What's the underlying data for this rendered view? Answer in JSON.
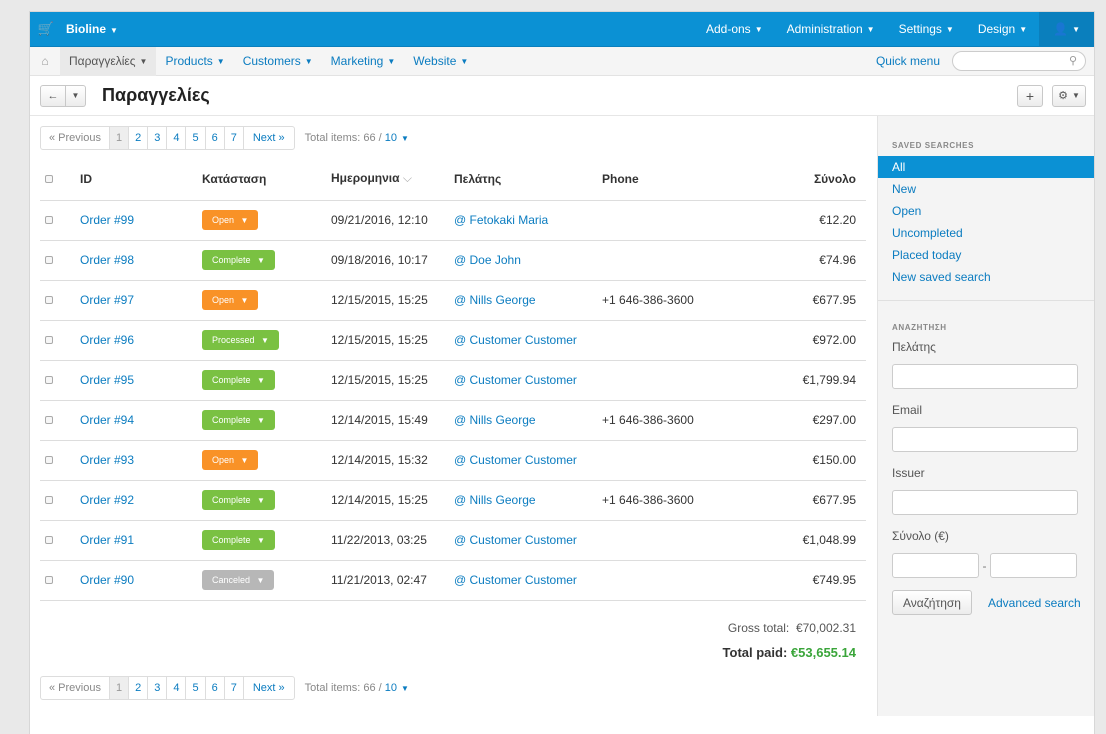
{
  "topbar": {
    "brand": "Bioline",
    "nav": [
      "Add-ons",
      "Administration",
      "Settings",
      "Design"
    ]
  },
  "subnav": {
    "items": [
      "Παραγγελίες",
      "Products",
      "Customers",
      "Marketing",
      "Website"
    ],
    "quick_menu": "Quick menu"
  },
  "page": {
    "title": "Παραγγελίες"
  },
  "pager": {
    "prev": "« Previous",
    "pages": [
      "1",
      "2",
      "3",
      "4",
      "5",
      "6",
      "7"
    ],
    "next": "Next »",
    "total_label": "Total items: 66 / ",
    "per_page": "10"
  },
  "table": {
    "headers": {
      "id": "ID",
      "status": "Κατάσταση",
      "date": "Ημερομηνια",
      "customer": "Πελάτης",
      "phone": "Phone",
      "total": "Σύνολο"
    },
    "rows": [
      {
        "id": "Order #99",
        "status": "Open",
        "status_type": "open",
        "date": "09/21/2016, 12:10",
        "customer": "@ Fetokaki Maria",
        "phone": "",
        "total": "€12.20"
      },
      {
        "id": "Order #98",
        "status": "Complete",
        "status_type": "complete",
        "date": "09/18/2016, 10:17",
        "customer": "@ Doe John",
        "phone": "",
        "total": "€74.96"
      },
      {
        "id": "Order #97",
        "status": "Open",
        "status_type": "open",
        "date": "12/15/2015, 15:25",
        "customer": "@ Nills George",
        "phone": "+1 646-386-3600",
        "total": "€677.95"
      },
      {
        "id": "Order #96",
        "status": "Processed",
        "status_type": "processed",
        "date": "12/15/2015, 15:25",
        "customer": "@ Customer Customer",
        "phone": "",
        "total": "€972.00"
      },
      {
        "id": "Order #95",
        "status": "Complete",
        "status_type": "complete",
        "date": "12/15/2015, 15:25",
        "customer": "@ Customer Customer",
        "phone": "",
        "total": "€1,799.94"
      },
      {
        "id": "Order #94",
        "status": "Complete",
        "status_type": "complete",
        "date": "12/14/2015, 15:49",
        "customer": "@ Nills George",
        "phone": "+1 646-386-3600",
        "total": "€297.00"
      },
      {
        "id": "Order #93",
        "status": "Open",
        "status_type": "open",
        "date": "12/14/2015, 15:32",
        "customer": "@ Customer Customer",
        "phone": "",
        "total": "€150.00"
      },
      {
        "id": "Order #92",
        "status": "Complete",
        "status_type": "complete",
        "date": "12/14/2015, 15:25",
        "customer": "@ Nills George",
        "phone": "+1 646-386-3600",
        "total": "€677.95"
      },
      {
        "id": "Order #91",
        "status": "Complete",
        "status_type": "complete",
        "date": "11/22/2013, 03:25",
        "customer": "@ Customer Customer",
        "phone": "",
        "total": "€1,048.99"
      },
      {
        "id": "Order #90",
        "status": "Canceled",
        "status_type": "canceled",
        "date": "11/21/2013, 02:47",
        "customer": "@ Customer Customer",
        "phone": "",
        "total": "€749.95"
      }
    ]
  },
  "totals": {
    "gross_label": "Gross total:",
    "gross_value": "€70,002.31",
    "paid_label": "Total paid:",
    "paid_value": "€53,655.14"
  },
  "sidebar": {
    "saved_title": "SAVED SEARCHES",
    "saved": [
      "All",
      "New",
      "Open",
      "Uncompleted",
      "Placed today",
      "New saved search"
    ],
    "search_title": "ΑΝΑΖΗΤΗΣΗ",
    "customer_label": "Πελάτης",
    "email_label": "Email",
    "issuer_label": "Issuer",
    "total_label": "Σύνολο (€)",
    "search_button": "Αναζήτηση",
    "advanced": "Advanced search"
  },
  "colors": {
    "accent": "#0b91d4",
    "link": "#0b7cc0",
    "open": "#f99227",
    "complete": "#7ac142",
    "canceled": "#b7b7b7",
    "paid": "#3aa53a"
  }
}
